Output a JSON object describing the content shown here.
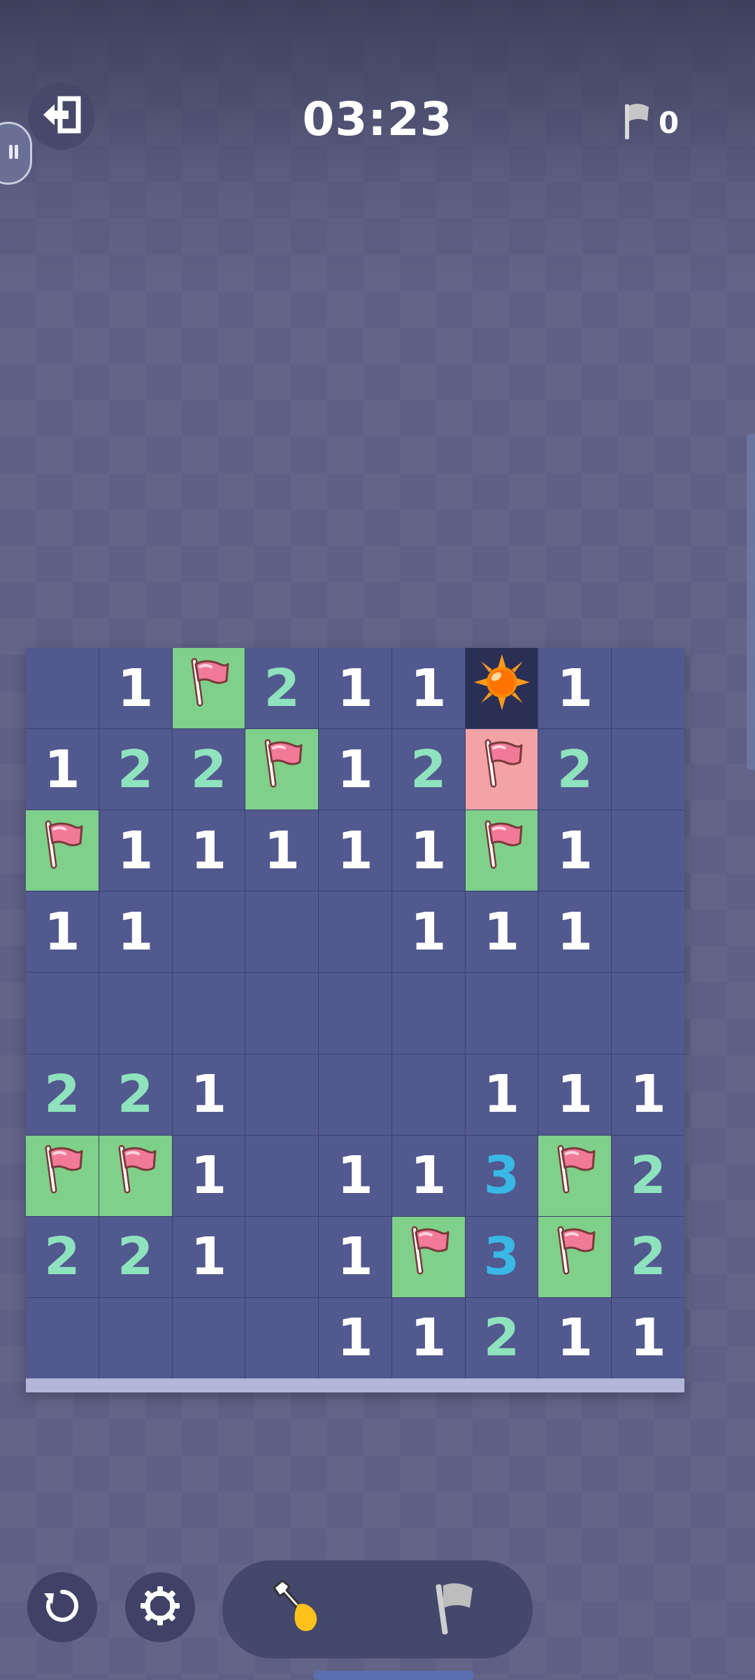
{
  "header": {
    "exit_icon": "exit-icon",
    "timer": "03:23",
    "flag_icon": "flag-icon",
    "flags_placed": "0"
  },
  "board": {
    "rows": 9,
    "cols": 9,
    "cells": [
      [
        {
          "t": "empty"
        },
        {
          "t": "num",
          "v": "1"
        },
        {
          "t": "flag"
        },
        {
          "t": "num",
          "v": "2"
        },
        {
          "t": "num",
          "v": "1"
        },
        {
          "t": "num",
          "v": "1"
        },
        {
          "t": "mine"
        },
        {
          "t": "num",
          "v": "1"
        },
        {
          "t": "empty"
        }
      ],
      [
        {
          "t": "num",
          "v": "1"
        },
        {
          "t": "num",
          "v": "2"
        },
        {
          "t": "num",
          "v": "2"
        },
        {
          "t": "flag"
        },
        {
          "t": "num",
          "v": "1"
        },
        {
          "t": "num",
          "v": "2"
        },
        {
          "t": "flag_wrong"
        },
        {
          "t": "num",
          "v": "2"
        },
        {
          "t": "empty"
        }
      ],
      [
        {
          "t": "flag"
        },
        {
          "t": "num",
          "v": "1"
        },
        {
          "t": "num",
          "v": "1"
        },
        {
          "t": "num",
          "v": "1"
        },
        {
          "t": "num",
          "v": "1"
        },
        {
          "t": "num",
          "v": "1"
        },
        {
          "t": "flag"
        },
        {
          "t": "num",
          "v": "1"
        },
        {
          "t": "empty"
        }
      ],
      [
        {
          "t": "num",
          "v": "1"
        },
        {
          "t": "num",
          "v": "1"
        },
        {
          "t": "empty"
        },
        {
          "t": "empty"
        },
        {
          "t": "empty"
        },
        {
          "t": "num",
          "v": "1"
        },
        {
          "t": "num",
          "v": "1"
        },
        {
          "t": "num",
          "v": "1"
        },
        {
          "t": "empty"
        }
      ],
      [
        {
          "t": "empty"
        },
        {
          "t": "empty"
        },
        {
          "t": "empty"
        },
        {
          "t": "empty"
        },
        {
          "t": "empty"
        },
        {
          "t": "empty"
        },
        {
          "t": "empty"
        },
        {
          "t": "empty"
        },
        {
          "t": "empty"
        }
      ],
      [
        {
          "t": "num",
          "v": "2"
        },
        {
          "t": "num",
          "v": "2"
        },
        {
          "t": "num",
          "v": "1"
        },
        {
          "t": "empty"
        },
        {
          "t": "empty"
        },
        {
          "t": "empty"
        },
        {
          "t": "num",
          "v": "1"
        },
        {
          "t": "num",
          "v": "1"
        },
        {
          "t": "num",
          "v": "1"
        }
      ],
      [
        {
          "t": "flag"
        },
        {
          "t": "flag"
        },
        {
          "t": "num",
          "v": "1"
        },
        {
          "t": "empty"
        },
        {
          "t": "num",
          "v": "1"
        },
        {
          "t": "num",
          "v": "1"
        },
        {
          "t": "num",
          "v": "3"
        },
        {
          "t": "flag"
        },
        {
          "t": "num",
          "v": "2"
        }
      ],
      [
        {
          "t": "num",
          "v": "2"
        },
        {
          "t": "num",
          "v": "2"
        },
        {
          "t": "num",
          "v": "1"
        },
        {
          "t": "empty"
        },
        {
          "t": "num",
          "v": "1"
        },
        {
          "t": "flag"
        },
        {
          "t": "num",
          "v": "3"
        },
        {
          "t": "flag"
        },
        {
          "t": "num",
          "v": "2"
        }
      ],
      [
        {
          "t": "empty"
        },
        {
          "t": "empty"
        },
        {
          "t": "empty"
        },
        {
          "t": "empty"
        },
        {
          "t": "num",
          "v": "1"
        },
        {
          "t": "num",
          "v": "1"
        },
        {
          "t": "num",
          "v": "2"
        },
        {
          "t": "num",
          "v": "1"
        },
        {
          "t": "num",
          "v": "1"
        }
      ]
    ],
    "colors": {
      "covered": "#51598e",
      "flag_correct_bg": "#7fd08a",
      "flag_wrong_bg": "#f3a3a6",
      "mine_bg": "#2a2f55",
      "num1": "#ffffff",
      "num2": "#8fe2be",
      "num3": "#39b8e6"
    }
  },
  "controls": {
    "undo_icon": "undo-icon",
    "settings_icon": "gear-icon",
    "dig_tool_icon": "shovel-icon",
    "flag_tool_icon": "flag-icon",
    "active_tool": "dig"
  }
}
